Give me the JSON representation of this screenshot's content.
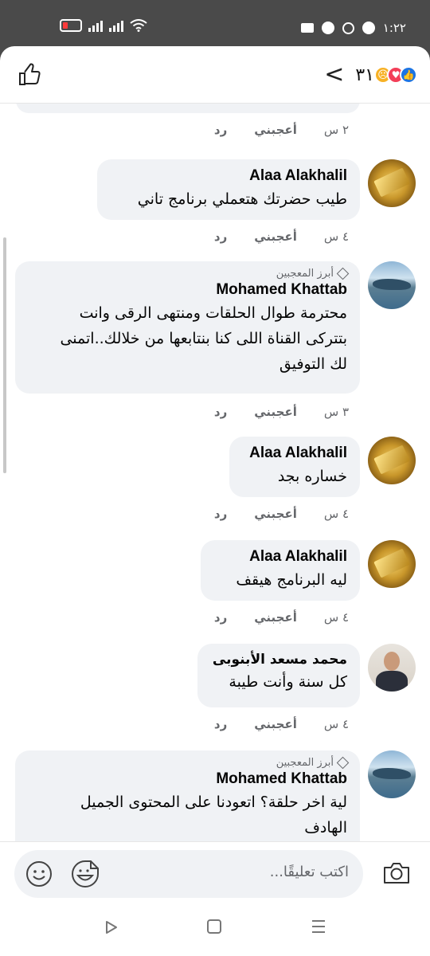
{
  "status_bar": {
    "time": "١:٢٢"
  },
  "header": {
    "reaction_count": "٣١",
    "reactions": [
      "like",
      "love",
      "care"
    ],
    "icons": [
      "like-outline-icon",
      "back-chevron-icon"
    ]
  },
  "comments": [
    {
      "author": "Alaa Alakhalil",
      "text": "طيب حضرتك هتعملي برنامج تاني",
      "time": "٤ س",
      "like": "أعجبني",
      "reply": "رد",
      "top_fan": null,
      "avatar": "gold-bars"
    },
    {
      "author": "Mohamed Khattab",
      "top_fan": "أبرز المعجبين",
      "text_lines": [
        "محترمة طوال الحلقات ومنتهى الرقى وانت",
        "بتتركى القناة اللى كنا بنتابعها من خلالك..اتمنى",
        "لك التوفيق"
      ],
      "time": "٣ س",
      "like": "أعجبني",
      "reply": "رد",
      "avatar": "lake"
    },
    {
      "author": "Alaa Alakhalil",
      "text": "خساره بجد",
      "time": "٤ س",
      "like": "أعجبني",
      "reply": "رد",
      "avatar": "gold-bars"
    },
    {
      "author": "Alaa Alakhalil",
      "text": "ليه البرنامج هيقف",
      "time": "٤ س",
      "like": "أعجبني",
      "reply": "رد",
      "avatar": "gold-bars"
    },
    {
      "author": "محمد مسعد الأبنوبى",
      "text": "كل سنة وأنت طيبة",
      "time": "٤ س",
      "like": "أعجبني",
      "reply": "رد",
      "avatar": "person"
    },
    {
      "author": "Mohamed Khattab",
      "top_fan": "أبرز المعجبين",
      "text_lines": [
        "لية اخر حلقة؟ اتعودنا على المحتوى الجميل",
        "الهادف"
      ],
      "avatar": "lake"
    }
  ],
  "first_actions": {
    "time": "٢ س",
    "like": "أعجبني",
    "reply": "رد"
  },
  "composer": {
    "placeholder": "اكتب تعليقًا..."
  },
  "colors": {
    "bubble": "#f0f2f5",
    "like_blue": "#1b74e4",
    "love_red": "#f33e58",
    "care_yellow": "#f7b125",
    "meta_gray": "#65676b"
  }
}
